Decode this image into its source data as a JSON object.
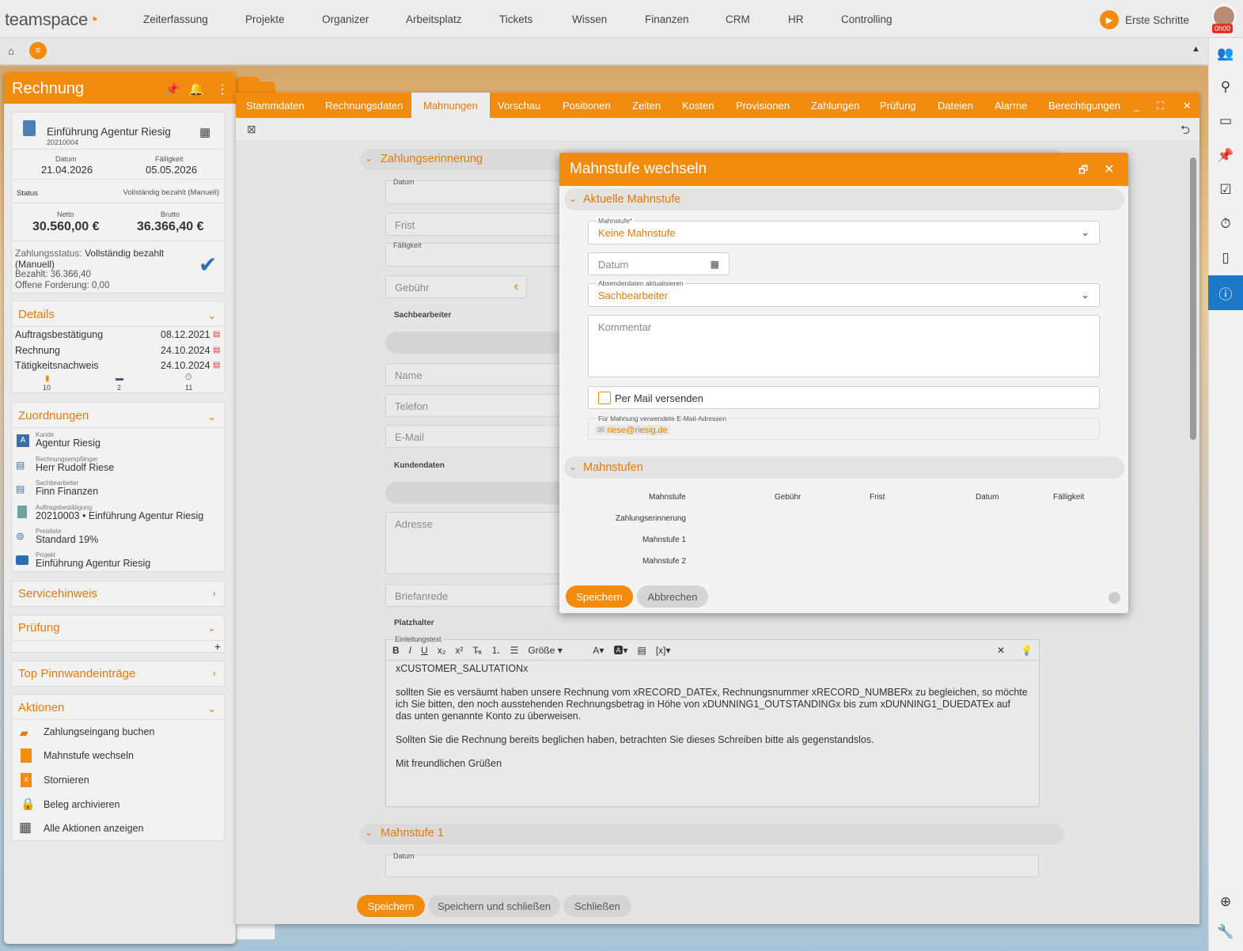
{
  "app": {
    "logo": "teamspace"
  },
  "nav": [
    "Zeiterfassung",
    "Projekte",
    "Organizer",
    "Arbeitsplatz",
    "Tickets",
    "Wissen",
    "Finanzen",
    "CRM",
    "HR",
    "Controlling"
  ],
  "erste_schritte": "Erste Schritte",
  "timer": "0h00",
  "left_panel": {
    "title": "Rechnung",
    "record": {
      "title": "Einführung Agentur Riesig",
      "number": "20210004"
    },
    "datum_label": "Datum",
    "datum": "21.04.2026",
    "faelligkeit_label": "Fälligkeit",
    "faelligkeit": "05.05.2026",
    "status_label": "Status",
    "status": "Vollständig bezahlt (Manuell)",
    "netto_label": "Netto",
    "netto": "30.560,00 €",
    "brutto_label": "Brutto",
    "brutto": "36.366,40 €",
    "zahlungsstatus_label": "Zahlungsstatus:",
    "zahlungsstatus": "Vollständig bezahlt (Manuell)",
    "bezahlt": "Bezahlt: 36.366,40",
    "offen": "Offene Forderung: 0,00",
    "details": {
      "title": "Details",
      "rows": [
        {
          "name": "Auftragsbestätigung",
          "date": "08.12.2021"
        },
        {
          "name": "Rechnung",
          "date": "24.10.2024"
        },
        {
          "name": "Tätigkeitsnachweis",
          "date": "24.10.2024"
        }
      ],
      "counts": [
        "10",
        "2",
        "11"
      ]
    },
    "zuordnungen": {
      "title": "Zuordnungen",
      "items": [
        {
          "label": "Kunde",
          "value": "Agentur Riesig"
        },
        {
          "label": "Rechnungsempfänger",
          "value": "Herr Rudolf Riese"
        },
        {
          "label": "Sachbearbeiter",
          "value": "Finn Finanzen"
        },
        {
          "label": "Auftragsbestätigung",
          "value": "20210003 • Einführung Agentur Riesig"
        },
        {
          "label": "Preisliste",
          "value": "Standard 19%"
        },
        {
          "label": "Projekt",
          "value": "Einführung Agentur Riesig"
        }
      ]
    },
    "servicehinweis": "Servicehinweis",
    "pruefung": "Prüfung",
    "pinnwand": "Top Pinnwandeinträge",
    "aktionen": {
      "title": "Aktionen",
      "items": [
        "Zahlungseingang buchen",
        "Mahnstufe wechseln",
        "Stornieren",
        "Beleg archivieren",
        "Alle Aktionen anzeigen"
      ]
    }
  },
  "main": {
    "tabs": [
      "Stammdaten",
      "Rechnungsdaten",
      "Mahnungen",
      "Vorschau",
      "Positionen",
      "Zeiten",
      "Kosten",
      "Provisionen",
      "Zahlungen",
      "Prüfung",
      "Dateien",
      "Alarme",
      "Berechtigungen"
    ],
    "sec_zahlungserinnerung": "Zahlungserinnerung",
    "datum_label": "Datum",
    "frist": "Frist",
    "faelligkeit_label": "Fälligkeit",
    "gebuehr": "Gebühr",
    "euro": "€",
    "sachbearbeiter": "Sachbearbeiter",
    "name": "Name",
    "telefon": "Telefon",
    "email": "E-Mail",
    "kundendaten": "Kundendaten",
    "adresse": "Adresse",
    "briefanrede": "Briefanrede",
    "platzhalter": "Platzhalter",
    "einleitungstext_label": "Einleitungstext",
    "groesse": "Größe",
    "text_line1": "xCUSTOMER_SALUTATIONx",
    "text_para1": "sollten Sie es versäumt haben unsere Rechnung vom xRECORD_DATEx, Rechnungsnummer xRECORD_NUMBERx zu begleichen, so möchte ich Sie bitten, den noch ausstehenden Rechnungsbetrag in Höhe von xDUNNING1_OUTSTANDINGx bis zum xDUNNING1_DUEDATEx auf das unten genannte Konto zu überweisen.",
    "text_para2": "Sollten Sie die Rechnung bereits beglichen haben, betrachten Sie dieses Schreiben bitte als gegenstandslos.",
    "text_para3": "Mit freundlichen Grüßen",
    "sec_mahnstufe1": "Mahnstufe 1",
    "datum2_label": "Datum",
    "btn_save": "Speichern",
    "btn_save_close": "Speichern und schließen",
    "btn_close": "Schließen"
  },
  "dialog": {
    "title": "Mahnstufe wechseln",
    "sec_current": "Aktuelle Mahnstufe",
    "mahnstufe_label": "Mahnstufe*",
    "mahnstufe_value": "Keine Mahnstufe",
    "datum_placeholder": "Datum",
    "absender_label": "Absenderdaten aktualisieren",
    "absender_value": "Sachbearbeiter",
    "kommentar_placeholder": "Kommentar",
    "per_mail": "Per Mail versenden",
    "email_label": "Für Mahnung verwendete E-Mail-Adressen",
    "email_value": "riese@riesig.de",
    "sec_levels": "Mahnstufen",
    "table_headers": [
      "Mahnstufe",
      "Gebühr",
      "Frist",
      "Datum",
      "Fälligkeit"
    ],
    "table_rows": [
      "Zahlungserinnerung",
      "Mahnstufe 1",
      "Mahnstufe 2"
    ],
    "btn_save": "Speichern",
    "btn_cancel": "Abbrechen"
  },
  "colors": {
    "accent": "#f28c0f",
    "accent_text": "#e27a0a",
    "active_blue": "#1e78c8"
  }
}
